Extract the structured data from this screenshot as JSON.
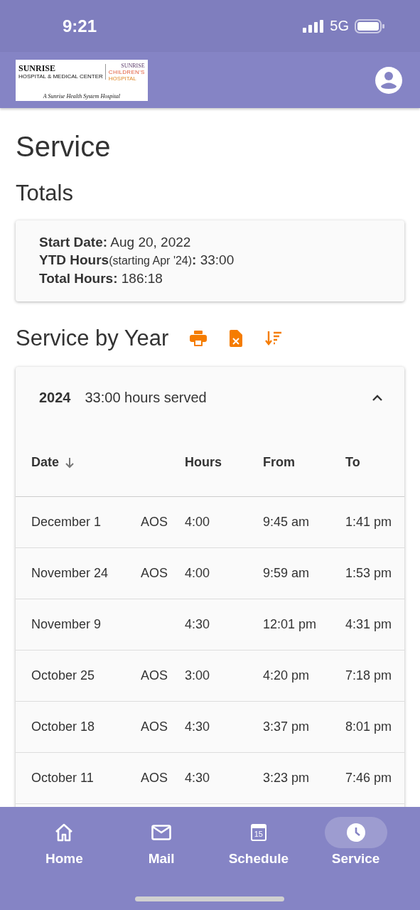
{
  "status_bar": {
    "time": "9:21",
    "network": "5G"
  },
  "header": {
    "logo": {
      "left_name": "SUNRISE",
      "left_sub": "HOSPITAL & MEDICAL CENTER",
      "right_top": "SUNRISE",
      "right_name_1": "CHILDREN'S",
      "right_name_2": "HOSPITAL",
      "tagline": "A Sunrise Health System Hospital"
    }
  },
  "page_title": "Service",
  "totals": {
    "heading": "Totals",
    "lines": [
      {
        "label": "Start Date:",
        "value": "Aug 20, 2022"
      },
      {
        "label": "YTD Hours",
        "note": "(starting Apr '24)",
        "label_end": ":",
        "value": "33:00"
      },
      {
        "label": "Total Hours:",
        "value": "186:18"
      }
    ]
  },
  "by_year": {
    "heading": "Service by Year",
    "year": {
      "year": "2024",
      "summary": "33:00 hours served",
      "expanded": true
    },
    "table": {
      "columns": [
        "Date",
        "",
        "Hours",
        "From",
        "To"
      ],
      "rows": [
        [
          "December 1",
          "AOS",
          "4:00",
          "9:45 am",
          "1:41 pm"
        ],
        [
          "November 24",
          "AOS",
          "4:00",
          "9:59 am",
          "1:53 pm"
        ],
        [
          "November 9",
          "",
          "4:30",
          "12:01 pm",
          "4:31 pm"
        ],
        [
          "October 25",
          "AOS",
          "3:00",
          "4:20 pm",
          "7:18 pm"
        ],
        [
          "October 18",
          "AOS",
          "4:30",
          "3:37 pm",
          "8:01 pm"
        ],
        [
          "October 11",
          "AOS",
          "4:30",
          "3:23 pm",
          "7:46 pm"
        ]
      ]
    }
  },
  "nav": [
    {
      "kind": "home",
      "label": "Home",
      "selected": false
    },
    {
      "kind": "mail",
      "label": "Mail",
      "selected": false
    },
    {
      "kind": "calendar",
      "label": "Schedule",
      "icon_text": "15",
      "selected": false
    },
    {
      "kind": "clock",
      "label": "Service",
      "selected": true
    }
  ]
}
